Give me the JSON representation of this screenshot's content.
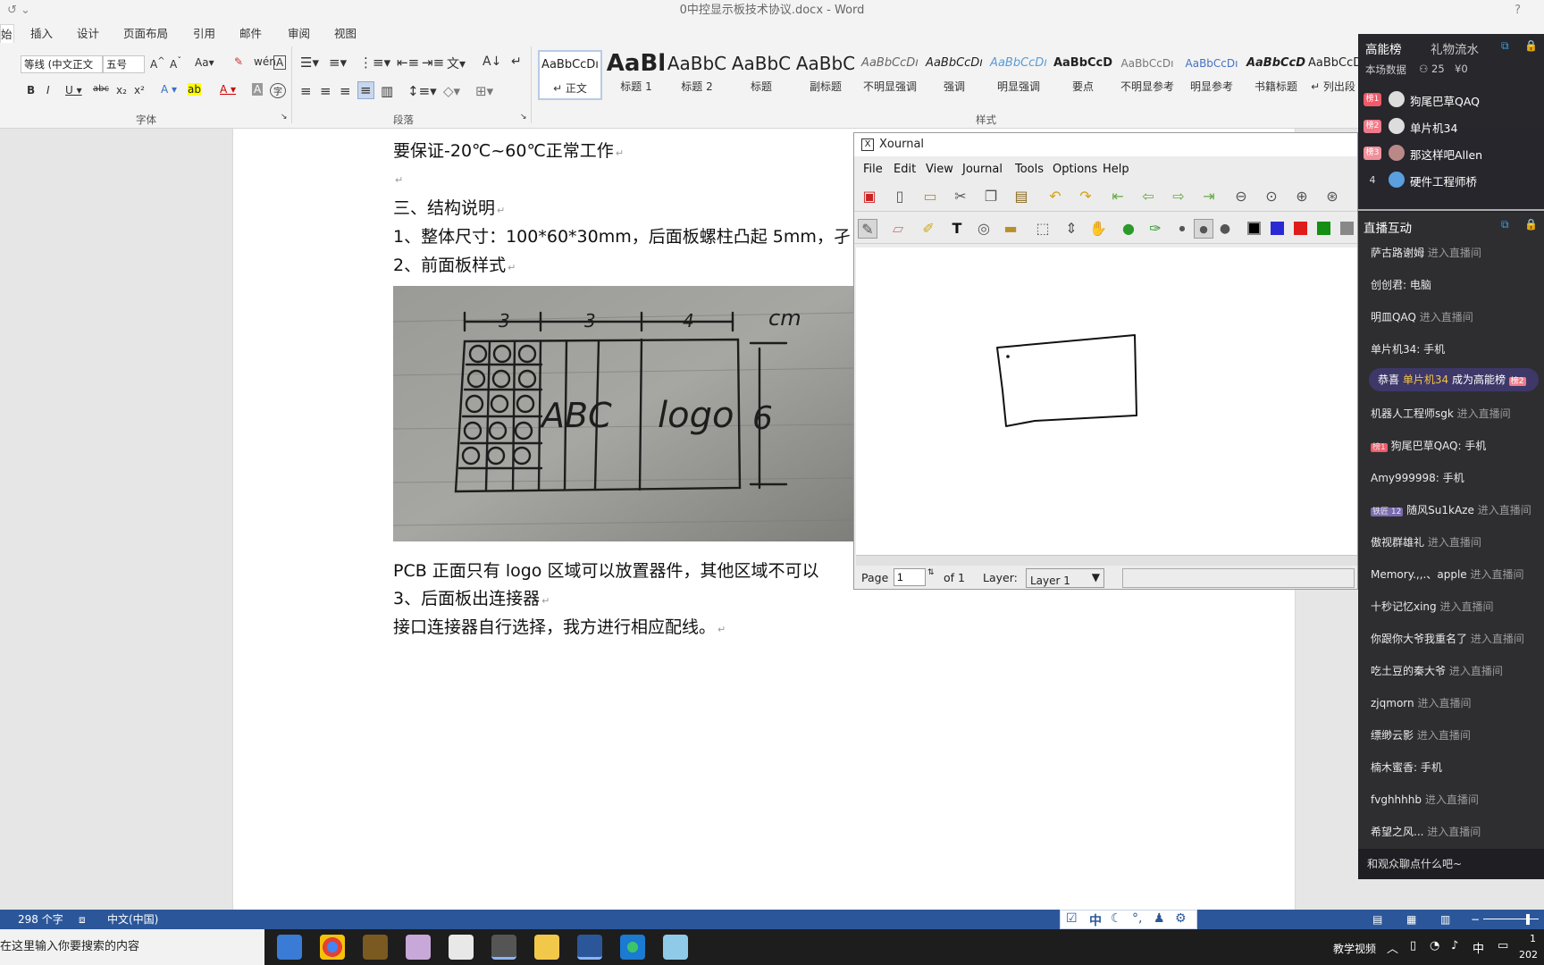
{
  "word": {
    "window_title": "0中控显示板技术协议.docx - Word",
    "help": "?",
    "tabs": [
      "插入",
      "设计",
      "页面布局",
      "引用",
      "邮件",
      "审阅",
      "视图"
    ],
    "font_name": "等线 (中文正文",
    "font_size": "五号",
    "group_font": "字体",
    "group_paragraph": "段落",
    "group_styles": "样式",
    "styles": [
      {
        "sample": "AaBbCcDı",
        "name": "↵ 正文"
      },
      {
        "sample": "AaBl",
        "name": "标题 1"
      },
      {
        "sample": "AaBbC",
        "name": "标题 2"
      },
      {
        "sample": "AaBbC",
        "name": "标题"
      },
      {
        "sample": "AaBbC",
        "name": "副标题"
      },
      {
        "sample": "AaBbCcDı",
        "name": "不明显强调"
      },
      {
        "sample": "AaBbCcDı",
        "name": "强调"
      },
      {
        "sample": "AaBbCcDı",
        "name": "明显强调"
      },
      {
        "sample": "AaBbCcD",
        "name": "要点"
      },
      {
        "sample": "AaBbCcDı",
        "name": "不明显参考"
      },
      {
        "sample": "AaBbCcDı",
        "name": "明显参考"
      },
      {
        "sample": "AaBbCcD",
        "name": "书籍标题"
      },
      {
        "sample": "AaBbCcDı",
        "name": "↵ 列出段"
      }
    ],
    "doc": {
      "line1": "要保证-20℃~60℃正常工作",
      "line2": "三、结构说明",
      "line3": "1、整体尺寸：100*60*30mm，后面板螺柱凸起 5mm，孑",
      "line4": "2、前面板样式",
      "line5": "PCB 正面只有 logo 区域可以放置器件，其他区域不可以",
      "line6": "3、后面板出连接器",
      "line7": "接口连接器自行选择，我方进行相应配线。"
    },
    "sketch": {
      "dim1": "3",
      "dim2": "3",
      "dim3": "4",
      "unit": "cm",
      "height": "6",
      "letters": "ABC",
      "logo": "logo"
    },
    "status": {
      "word_count": "298 个字",
      "language": "中文(中国)"
    }
  },
  "taskbar": {
    "search_placeholder": "在这里输入你要搜索的内容",
    "tray_app": "教学视频",
    "ime": "中",
    "time": "1",
    "date": "202"
  },
  "ime_bar": {
    "mode": "中"
  },
  "xournal": {
    "title": "Xournal",
    "menu": [
      "File",
      "Edit",
      "View",
      "Journal",
      "Tools",
      "Options",
      "Help"
    ],
    "page_label": "Page",
    "page_value": "1",
    "page_of": "of 1",
    "layer_label": "Layer:",
    "layer_value": "Layer 1",
    "colors": [
      "#000000",
      "#2a2ad4",
      "#e01b1b",
      "#138f13",
      "#888888"
    ]
  },
  "live": {
    "tab_rank": "高能榜",
    "tab_gift": "礼物流水",
    "stats_label": "本场数据",
    "viewer_count": "25",
    "coin_count": "¥0",
    "ranking": [
      {
        "badge": "榜1",
        "name": "狗尾巴草QAQ"
      },
      {
        "badge": "榜2",
        "name": "单片机34"
      },
      {
        "badge": "榜3",
        "name": "那这样吧Allen"
      },
      {
        "badge": "4",
        "name": "硬件工程师桥"
      }
    ],
    "interaction_title": "直播互动",
    "chat": [
      {
        "user": "萨古路谢姆",
        "text": "进入直播间"
      },
      {
        "user": "创创君: 电脑",
        "text": ""
      },
      {
        "user": "明皿QAQ",
        "text": "进入直播间"
      },
      {
        "user": "单片机34: 手机",
        "text": ""
      },
      {
        "user": "",
        "text": "",
        "congrats_prefix": "恭喜",
        "congrats_user": "单片机34",
        "congrats_suffix": "成为高能榜",
        "congrats_badge": "榜2"
      },
      {
        "user": "机器人工程师sgk",
        "text": "进入直播间"
      },
      {
        "user": "狗尾巴草QAQ: 手机",
        "text": "",
        "badge": "榜1"
      },
      {
        "user": "Amy999998: 手机",
        "text": ""
      },
      {
        "user": "随风Su1kAze",
        "text": "进入直播间",
        "badge": "铁匠 12"
      },
      {
        "user": "傲视群雄礼",
        "text": "进入直播间"
      },
      {
        "user": "Memory.,,.、apple",
        "text": "进入直播间"
      },
      {
        "user": "十秒记忆xing",
        "text": "进入直播间"
      },
      {
        "user": "你跟你大爷我重名了",
        "text": "进入直播间"
      },
      {
        "user": "吃土豆的秦大爷",
        "text": "进入直播间"
      },
      {
        "user": "zjqmorn",
        "text": "进入直播间"
      },
      {
        "user": "缥缈云影",
        "text": "进入直播间"
      },
      {
        "user": "楠木蜜香: 手机",
        "text": ""
      },
      {
        "user": "fvghhhhb",
        "text": "进入直播间"
      },
      {
        "user": "希望之风...",
        "text": "进入直播间"
      }
    ],
    "chat_placeholder": "和观众聊点什么吧~"
  }
}
